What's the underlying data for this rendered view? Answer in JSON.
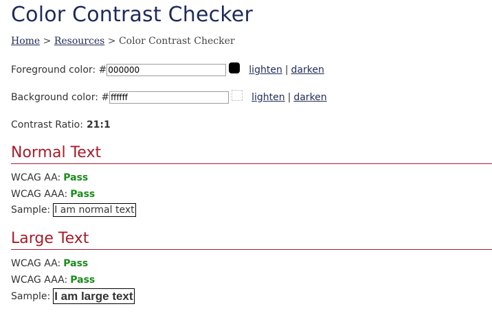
{
  "header": {
    "title": "Color Contrast Checker"
  },
  "breadcrumb": {
    "home": "Home",
    "resources": "Resources",
    "separator": ">",
    "current": "Color Contrast Checker"
  },
  "foreground": {
    "label": "Foreground color: #",
    "value": "000000",
    "lighten": "lighten",
    "darken": "darken",
    "divider": "|"
  },
  "background": {
    "label": "Background color: #",
    "value": "ffffff",
    "lighten": "lighten",
    "darken": "darken",
    "divider": "|"
  },
  "contrast": {
    "label": "Contrast Ratio:",
    "value": "21:1"
  },
  "normal": {
    "heading": "Normal Text",
    "aa_label": "WCAG AA:",
    "aa_result": "Pass",
    "aaa_label": "WCAG AAA:",
    "aaa_result": "Pass",
    "sample_label": "Sample:",
    "sample_text": "I am normal text"
  },
  "large": {
    "heading": "Large Text",
    "aa_label": "WCAG AA:",
    "aa_result": "Pass",
    "aaa_label": "WCAG AAA:",
    "aaa_result": "Pass",
    "sample_label": "Sample:",
    "sample_text": "I am large text"
  },
  "colors": {
    "title": "#1f2a5a",
    "link": "#1f2a5a",
    "section_heading": "#a61b29",
    "pass": "#1a8a1a",
    "foreground_swatch": "#000000",
    "background_swatch": "#ffffff"
  }
}
